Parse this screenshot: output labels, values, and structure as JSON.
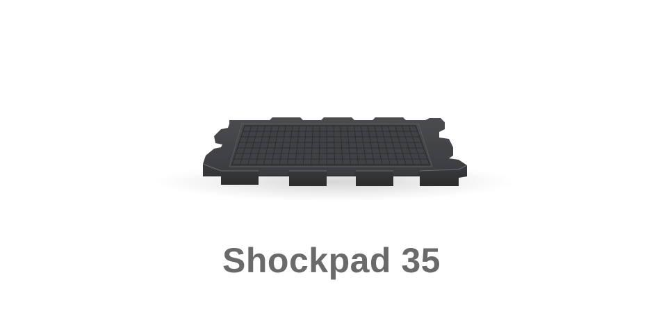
{
  "product": {
    "title": "Shockpad 35",
    "color": "#6a6a6a",
    "tile_color": "#3f4143",
    "tile_edge_color": "#2e3032",
    "grid_color": "#2a2c2e",
    "grid_columns": 25,
    "grid_rows": 7
  }
}
